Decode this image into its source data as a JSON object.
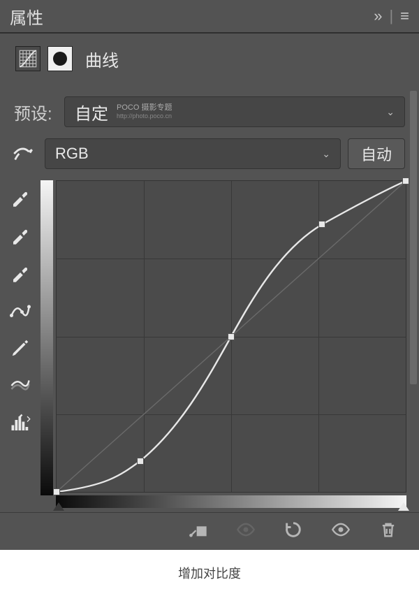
{
  "header": {
    "title": "属性"
  },
  "adjustment": {
    "name": "曲线"
  },
  "preset": {
    "label": "预设:",
    "value": "自定"
  },
  "watermark": {
    "line1": "POCO 摄影专题",
    "line2": "http://photo.poco.cn"
  },
  "channel": {
    "value": "RGB",
    "auto_label": "自动"
  },
  "caption": "增加对比度",
  "chart_data": {
    "type": "line",
    "title": "曲线",
    "xlabel": "",
    "ylabel": "",
    "xlim": [
      0,
      255
    ],
    "ylim": [
      0,
      255
    ],
    "baseline": [
      [
        0,
        0
      ],
      [
        255,
        255
      ]
    ],
    "series": [
      {
        "name": "RGB",
        "points": [
          [
            0,
            0
          ],
          [
            61,
            25
          ],
          [
            128,
            128
          ],
          [
            193,
            219
          ],
          [
            255,
            255
          ]
        ]
      }
    ]
  }
}
